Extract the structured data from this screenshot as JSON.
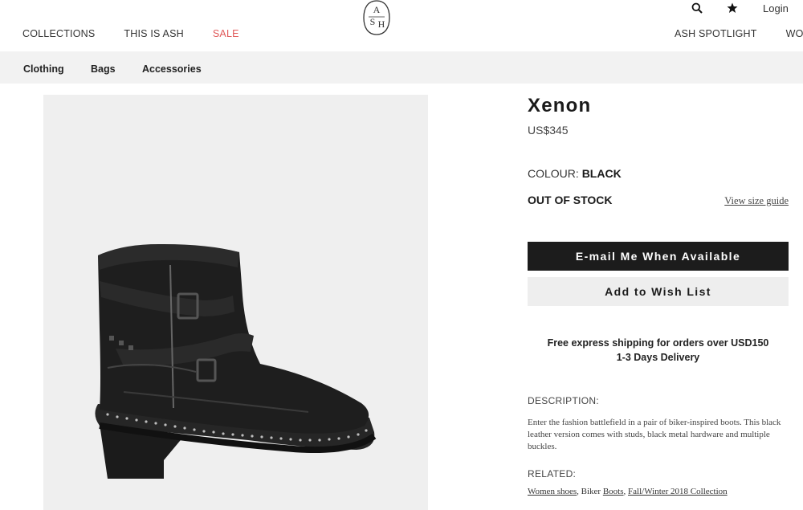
{
  "header": {
    "nav_left": [
      "COLLECTIONS",
      "THIS IS ASH",
      "SALE"
    ],
    "nav_right": [
      "ASH SPOTLIGHT",
      "WORLD"
    ],
    "logo_letters": [
      "A",
      "S",
      "H"
    ],
    "login_label": "Login",
    "icons": [
      "search-icon",
      "star-icon"
    ],
    "sale_color": "#e05a5a"
  },
  "subnav": {
    "items": [
      "Clothing",
      "Bags",
      "Accessories"
    ]
  },
  "product": {
    "name": "Xenon",
    "price": "US$345",
    "colour_label": "COLOUR:",
    "colour_value": "BLACK",
    "stock_status": "OUT OF STOCK",
    "size_guide_label": "View size guide",
    "email_button": "E-mail Me When Available",
    "wishlist_button": "Add to Wish List",
    "shipping_line1": "Free express shipping for orders over USD150",
    "shipping_line2": "1-3 Days Delivery",
    "description_label": "DESCRIPTION:",
    "description_text": "Enter the fashion battlefield in a pair of biker-inspired boots. This black leather version comes with studs, black metal hardware and multiple buckles.",
    "related_label": "RELATED:",
    "related_links": [
      "Women shoes",
      "Biker Boots",
      "Fall/Winter 2018 Collection"
    ],
    "related_sep_1": ", Biker ",
    "related_sep_2": ", "
  },
  "related_link_text": {
    "a": "Women shoes",
    "b": "Boots",
    "c": "Fall/Winter 2018 Collection"
  },
  "colors": {
    "primary_button_bg": "#1c1c1c",
    "secondary_button_bg": "#eeeeee",
    "subnav_bg": "#f2f2f2",
    "image_bg": "#efefef"
  }
}
